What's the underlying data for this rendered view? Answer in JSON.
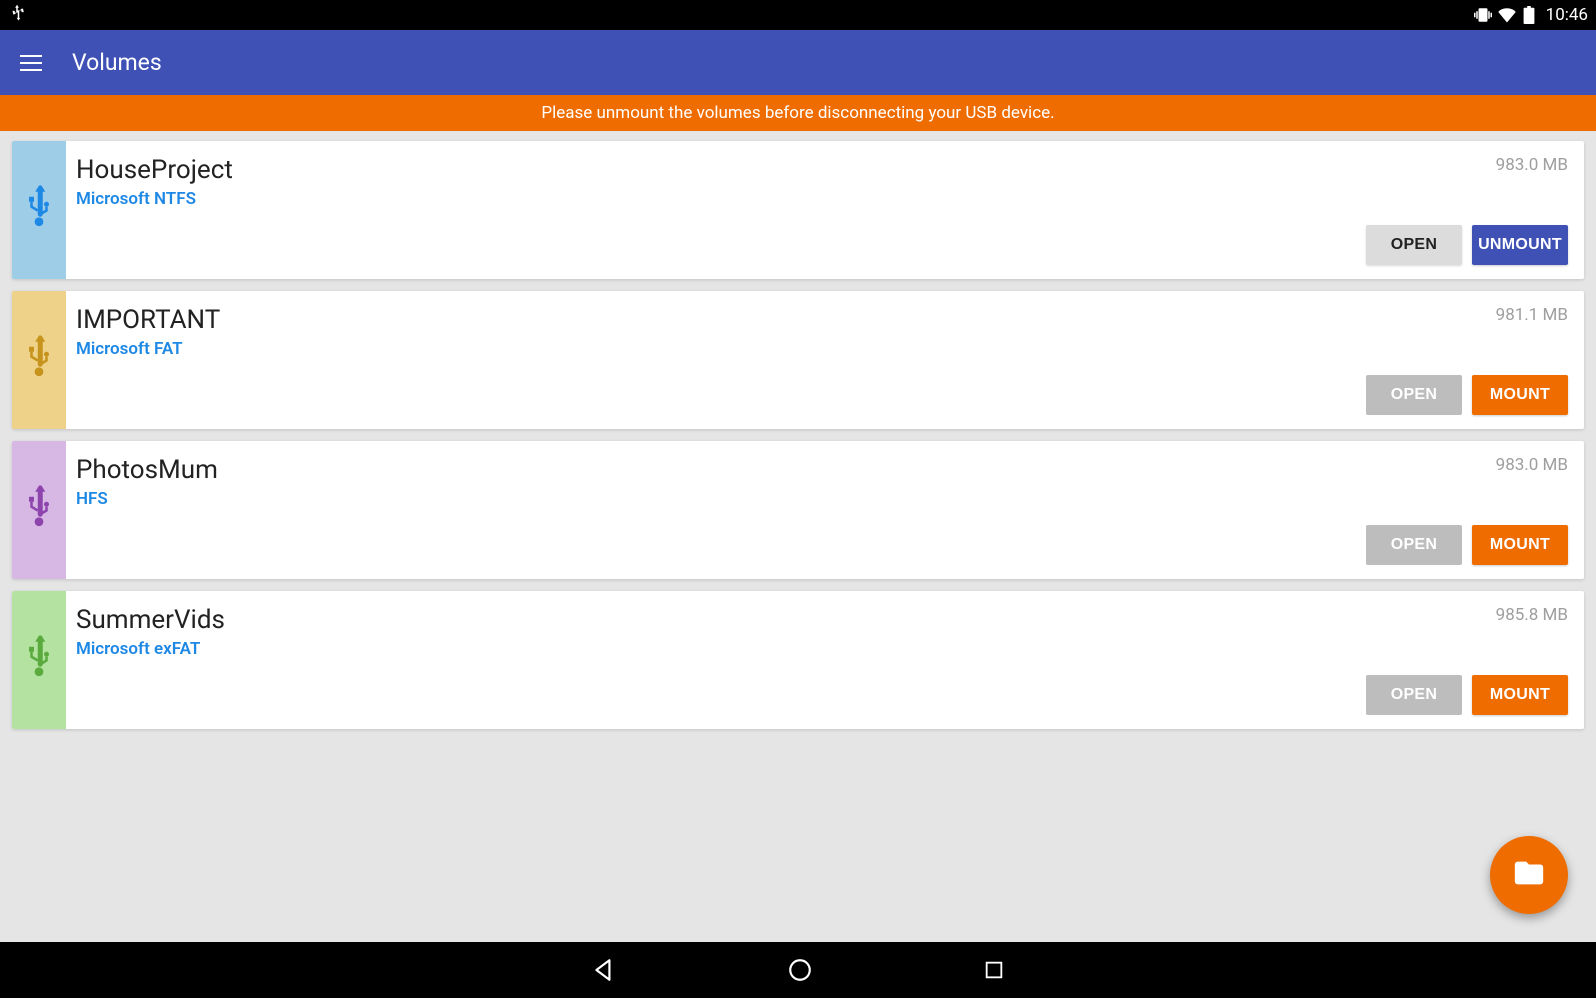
{
  "status": {
    "time": "10:46"
  },
  "appbar": {
    "title": "Volumes"
  },
  "banner": {
    "text": "Please unmount the volumes before disconnecting your USB device."
  },
  "labels": {
    "open": "OPEN",
    "mount": "MOUNT",
    "unmount": "UNMOUNT"
  },
  "volumes": [
    {
      "name": "HouseProject",
      "fs": "Microsoft NTFS",
      "size": "983.0 MB",
      "stripBg": "#9ecde8",
      "iconColor": "#1e88e5",
      "mounted": true
    },
    {
      "name": "IMPORTANT",
      "fs": "Microsoft FAT",
      "size": "981.1 MB",
      "stripBg": "#efd28a",
      "iconColor": "#c6931d",
      "mounted": false
    },
    {
      "name": "PhotosMum",
      "fs": "HFS",
      "size": "983.0 MB",
      "stripBg": "#d7b8e5",
      "iconColor": "#8e44ad",
      "mounted": false
    },
    {
      "name": "SummerVids",
      "fs": "Microsoft exFAT",
      "size": "985.8 MB",
      "stripBg": "#b4e2a1",
      "iconColor": "#5aaa3d",
      "mounted": false
    }
  ]
}
